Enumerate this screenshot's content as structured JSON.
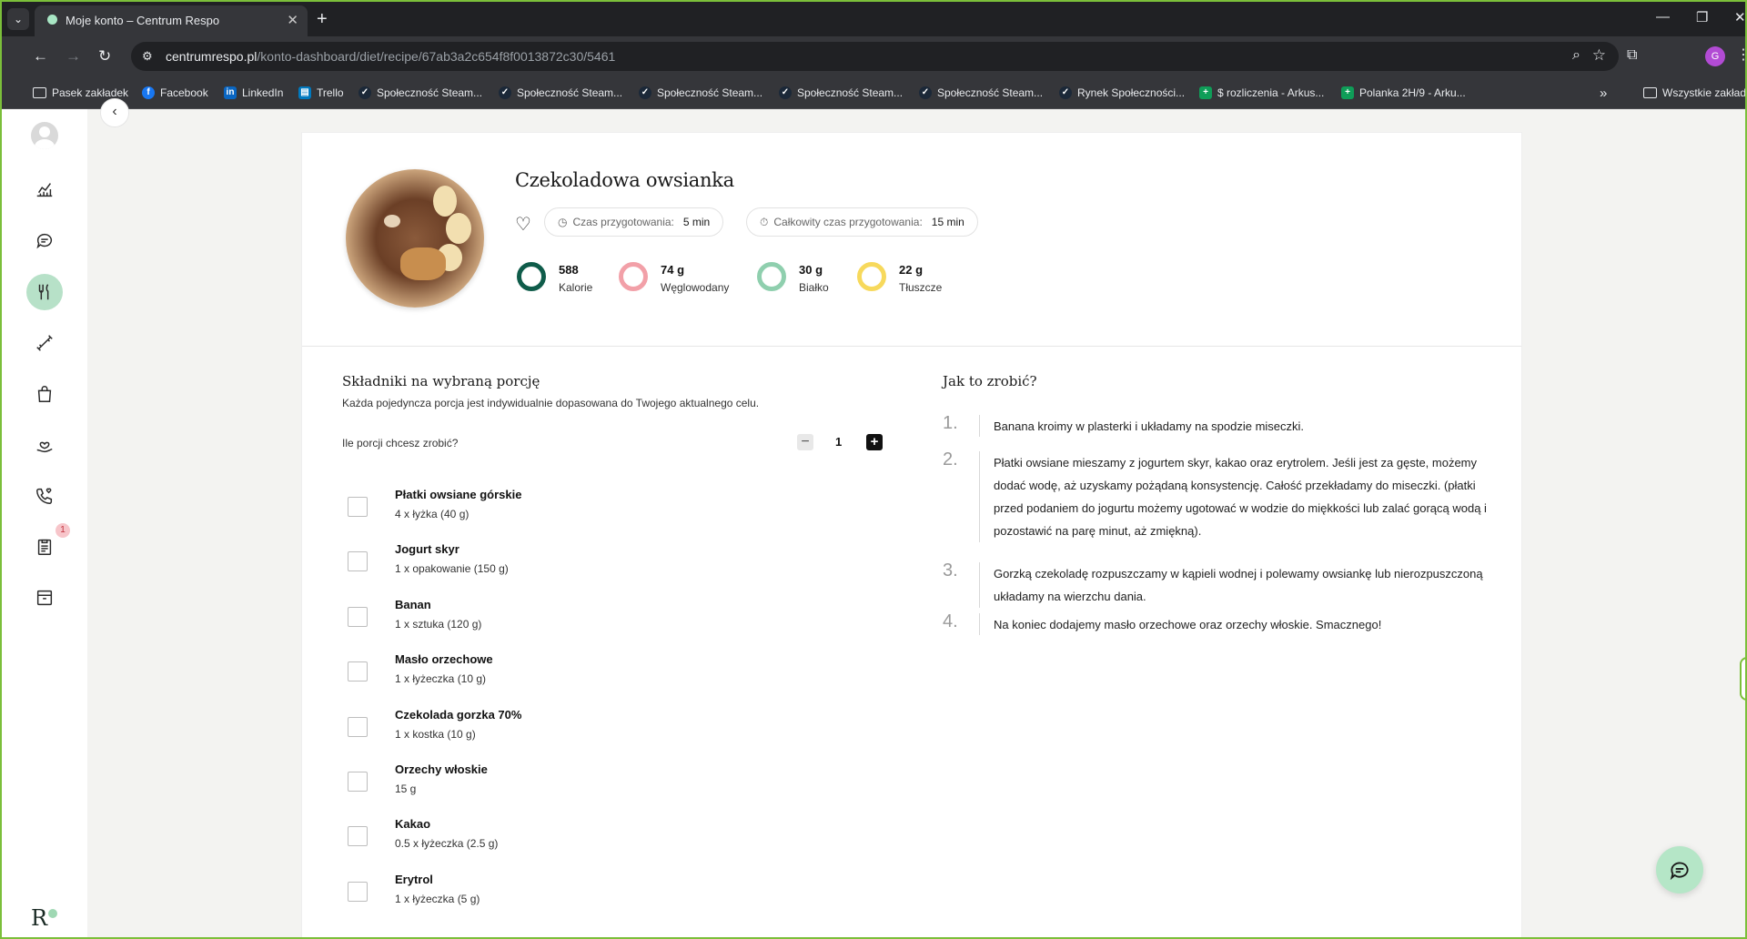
{
  "browser": {
    "tab_title": "Moje konto – Centrum Respo",
    "tab_close": "✕",
    "new_tab": "+",
    "url_domain": "centrumrespo.pl",
    "url_path": "/konto-dashboard/diet/recipe/67ab3a2c654f8f0013872c30/5461",
    "profile_initial": "G",
    "bookmarks": [
      {
        "label": "Pasek zakładek",
        "icon": "folder-icon"
      },
      {
        "label": "Facebook",
        "icon": "facebook-icon"
      },
      {
        "label": "LinkedIn",
        "icon": "linkedin-icon"
      },
      {
        "label": "Trello",
        "icon": "trello-icon"
      },
      {
        "label": "Społeczność Steam...",
        "icon": "steam-icon"
      },
      {
        "label": "Społeczność Steam...",
        "icon": "steam-icon"
      },
      {
        "label": "Społeczność Steam...",
        "icon": "steam-icon"
      },
      {
        "label": "Społeczność Steam...",
        "icon": "steam-icon"
      },
      {
        "label": "Społeczność Steam...",
        "icon": "steam-icon"
      },
      {
        "label": "Rynek Społeczności...",
        "icon": "steam-icon"
      },
      {
        "label": "$ rozliczenia - Arkus...",
        "icon": "sheets-icon"
      },
      {
        "label": "Polanka 2H/9 - Arku...",
        "icon": "sheets-icon"
      }
    ],
    "bookmarks_overflow": "»",
    "all_bookmarks": "Wszystkie zakładki"
  },
  "sidebar": {
    "notifications_badge": "1",
    "logo": "R"
  },
  "recipe": {
    "title": "Czekoladowa owsianka",
    "prep_time_label": "Czas przygotowania:",
    "prep_time_value": "5 min",
    "total_time_label": "Całkowity czas przygotowania:",
    "total_time_value": "15 min",
    "macros": [
      {
        "value": "588",
        "label": "Kalorie",
        "color": "#0f5c4a"
      },
      {
        "value": "74 g",
        "label": "Węglowodany",
        "color": "#f2a0a8"
      },
      {
        "value": "30 g",
        "label": "Białko",
        "color": "#8fcfae"
      },
      {
        "value": "22 g",
        "label": "Tłuszcze",
        "color": "#f7d95c"
      }
    ]
  },
  "ingredients": {
    "title": "Składniki na wybraną porcję",
    "subtitle": "Każda pojedyncza porcja jest indywidualnie dopasowana do Twojego aktualnego celu.",
    "portions_question": "Ile porcji chcesz zrobić?",
    "portions_minus": "−",
    "portions_value": "1",
    "portions_plus": "+",
    "items": [
      {
        "name": "Płatki owsiane górskie",
        "amount": "4 x łyżka (40 g)"
      },
      {
        "name": "Jogurt skyr",
        "amount": "1 x opakowanie (150 g)"
      },
      {
        "name": "Banan",
        "amount": "1 x sztuka (120 g)"
      },
      {
        "name": "Masło orzechowe",
        "amount": "1 x łyżeczka (10 g)"
      },
      {
        "name": "Czekolada gorzka 70%",
        "amount": "1 x kostka (10 g)"
      },
      {
        "name": "Orzechy włoskie",
        "amount": "15 g"
      },
      {
        "name": "Kakao",
        "amount": "0.5 x łyżeczka (2.5 g)"
      },
      {
        "name": "Erytrol",
        "amount": "1 x łyżeczka (5 g)"
      }
    ]
  },
  "instructions": {
    "title": "Jak to zrobić?",
    "steps": [
      {
        "num": "1.",
        "text": "Banana kroimy w plasterki i układamy na spodzie miseczki."
      },
      {
        "num": "2.",
        "text": "Płatki owsiane mieszamy z jogurtem skyr, kakao oraz erytrolem. Jeśli jest za gęste, możemy dodać wodę, aż uzyskamy pożądaną konsystencję. Całość przekładamy do miseczki. (płatki przed podaniem do jogurtu możemy ugotować w wodzie do miękkości lub zalać gorącą wodą i pozostawić na parę minut, aż zmiękną)."
      },
      {
        "num": "3.",
        "text": "Gorzką czekoladę rozpuszczamy w kąpieli wodnej i polewamy owsiankę lub nierozpuszczoną układamy na wierzchu dania."
      },
      {
        "num": "4.",
        "text": "Na koniec dodajemy masło orzechowe oraz orzechy włoskie. Smacznego!"
      }
    ]
  }
}
